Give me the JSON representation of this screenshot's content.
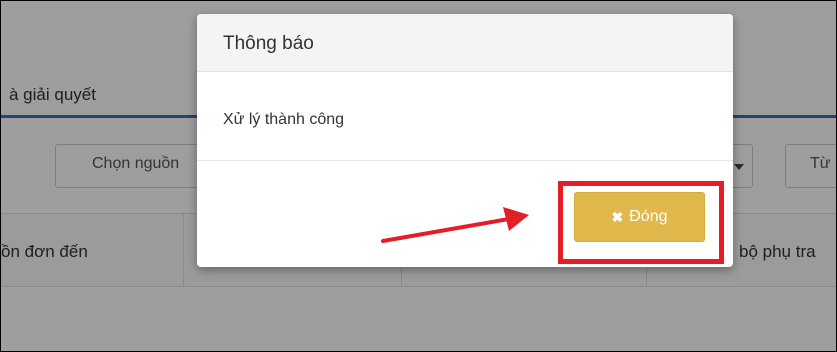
{
  "background": {
    "tab_label": "à giải quyết",
    "filters": {
      "source_select": "Chọn nguồn",
      "date_from": "Từ"
    },
    "table_headers": [
      "ồn đơn đến",
      "bộ phụ tra"
    ]
  },
  "dialog": {
    "title": "Thông báo",
    "message": "Xử lý thành công",
    "close_button_label": "Đóng",
    "close_icon": "close-icon"
  },
  "annotation": {
    "arrow": "red-arrow-icon",
    "highlight_color": "#e41e26"
  },
  "colors": {
    "button_bg": "#e0b84c",
    "tab_underline": "#3c6eb4",
    "header_bg": "#f3f4f6"
  }
}
